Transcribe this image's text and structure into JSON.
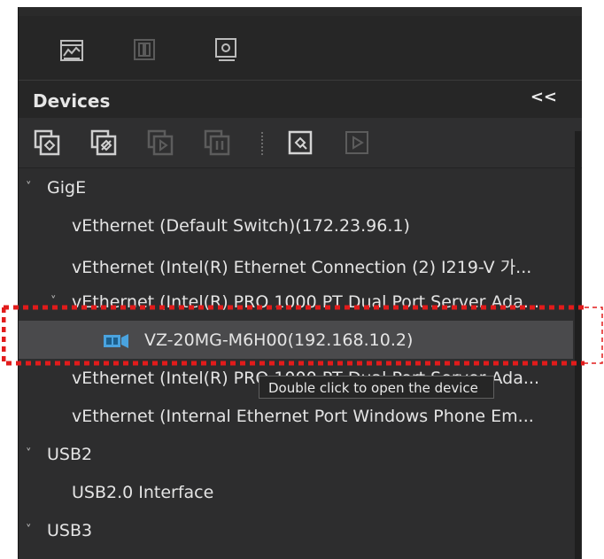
{
  "top_toolbar": {
    "buttons": [
      {
        "icon": "image-chart-icon"
      },
      {
        "icon": "pause-icon"
      },
      {
        "icon": "image-settings-icon"
      }
    ]
  },
  "devices_panel": {
    "title": "Devices",
    "collapse_glyph": "<<",
    "toolbar_buttons": [
      {
        "icon": "open-device-icon"
      },
      {
        "icon": "close-device-icon"
      },
      {
        "icon": "start-grab-icon"
      },
      {
        "icon": "stop-grab-icon"
      },
      {
        "icon": "device-settings-icon"
      },
      {
        "icon": "play-icon"
      }
    ]
  },
  "tree": {
    "expanded_glyph": "˅",
    "rows": [
      {
        "label": "GigE"
      },
      {
        "label": "vEthernet (Default Switch)(172.23.96.1)"
      },
      {
        "label": "vEthernet (Intel(R) Ethernet Connection (2) I219-V 가..."
      },
      {
        "label": "vEthernet (Intel(R) PRO 1000 PT Dual Port Server Ada..."
      },
      {
        "label": "VZ-20MG-M6H00(192.168.10.2)",
        "selected": true
      },
      {
        "label": "vEthernet (Intel(R) PRO 1000 PT Dual Port Server Ada..."
      },
      {
        "label": "vEthernet (Internal Ethernet Port Windows Phone Em..."
      },
      {
        "label": "USB2"
      },
      {
        "label": "USB2.0 Interface"
      },
      {
        "label": "USB3"
      }
    ]
  },
  "tooltip": {
    "text": "Double click to open the device"
  },
  "colors": {
    "panel_bg": "#2d2d2e",
    "selected_row": "#4a4a4c",
    "camera_icon": "#4aa3df",
    "highlight_annotation": "#e21b1b"
  }
}
